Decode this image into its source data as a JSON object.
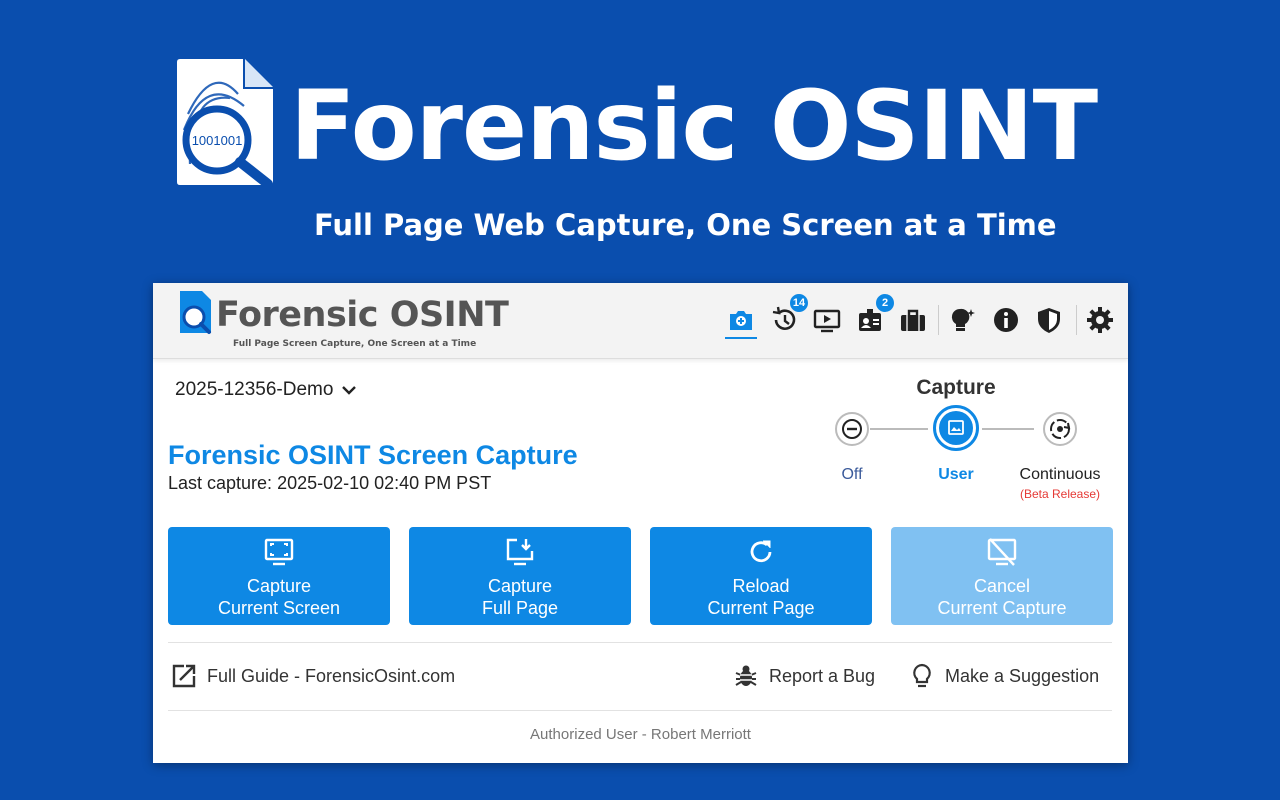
{
  "hero": {
    "title": "Forensic OSINT",
    "subtitle": "Full Page Web Capture, One Screen at a Time",
    "logo_text": "1001001"
  },
  "header": {
    "title": "Forensic OSINT",
    "subtitle": "Full Page Screen Capture, One Screen at a Time",
    "icons": [
      {
        "name": "camera-icon",
        "active": true
      },
      {
        "name": "history-icon",
        "badge": "14"
      },
      {
        "name": "video-icon"
      },
      {
        "name": "id-card-icon",
        "badge": "2"
      },
      {
        "name": "briefcase-icon"
      },
      {
        "name": "lightbulb-icon"
      },
      {
        "name": "info-icon"
      },
      {
        "name": "shield-icon"
      },
      {
        "name": "gear-icon"
      }
    ]
  },
  "case": {
    "selected": "2025-12356-Demo"
  },
  "main": {
    "title": "Forensic OSINT Screen Capture",
    "last_capture": "Last capture: 2025-02-10 02:40 PM PST"
  },
  "capture_mode": {
    "label": "Capture",
    "modes": [
      {
        "label": "Off"
      },
      {
        "label": "User",
        "selected": true
      },
      {
        "label": "Continuous",
        "note": "(Beta Release)"
      }
    ]
  },
  "actions": [
    {
      "line1": "Capture",
      "line2": "Current Screen",
      "icon": "screen-capture-icon"
    },
    {
      "line1": "Capture",
      "line2": "Full Page",
      "icon": "full-page-download-icon"
    },
    {
      "line1": "Reload",
      "line2": "Current Page",
      "icon": "reload-icon"
    },
    {
      "line1": "Cancel",
      "line2": "Current Capture",
      "icon": "cancel-screen-icon",
      "disabled": true
    }
  ],
  "links": {
    "guide": "Full Guide - ForensicOsint.com",
    "bug": "Report a Bug",
    "suggestion": "Make a Suggestion"
  },
  "footer": {
    "user": "Authorized User - Robert Merriott"
  },
  "colors": {
    "background": "#0a4eae",
    "accent": "#0e88e4",
    "accent_disabled": "#80c1f2",
    "beta": "#e53935"
  }
}
